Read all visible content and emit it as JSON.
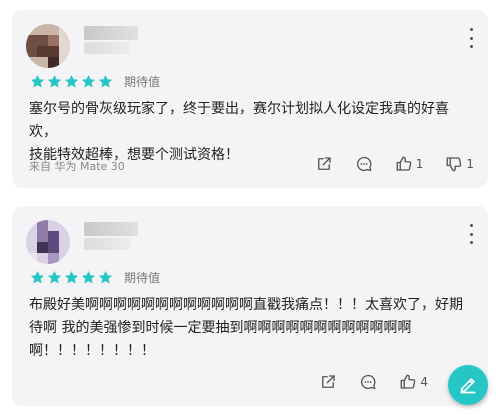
{
  "accent_color": "#26c6c6",
  "reviews": [
    {
      "rating": 5,
      "tag": "期待值",
      "text_lines": [
        "塞尔号的骨灰级玩家了，终于要出，赛尔计划拟人化设定我真的好喜欢，",
        "技能特效超棒，想要个测试资格！"
      ],
      "source": "来自 华为 Mate 30",
      "like_count": "1",
      "dislike_count": "1"
    },
    {
      "rating": 5,
      "tag": "期待值",
      "text_lines": [
        "布殿好美啊啊啊啊啊啊啊啊啊啊啊啊直戳我痛点！！！太喜欢了，好期",
        "待啊 我的美强惨到时候一定要抽到啊啊啊啊啊啊啊啊啊啊啊啊",
        "啊！！！！！！！！"
      ],
      "like_count": "4"
    }
  ],
  "icons": {
    "share": "share-icon",
    "comment": "comment-icon",
    "like": "thumbs-up-icon",
    "dislike": "thumbs-down-icon",
    "more": "more-vertical-icon",
    "write": "pencil-icon"
  }
}
